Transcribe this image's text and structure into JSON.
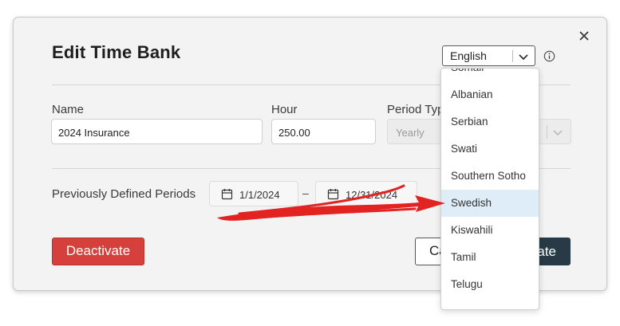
{
  "dialog": {
    "title": "Edit Time Bank",
    "language": {
      "selected": "English"
    },
    "fields": {
      "name": {
        "label": "Name",
        "value": "2024 Insurance"
      },
      "hour": {
        "label": "Hour",
        "value": "250.00"
      },
      "period_type": {
        "label": "Period Type",
        "value": "Yearly"
      }
    },
    "previous_periods": {
      "label": "Previously Defined Periods",
      "start": "1/1/2024",
      "separator": "–",
      "end": "12/31/2024"
    },
    "buttons": {
      "deactivate": "Deactivate",
      "cancel": "Cancel",
      "update": "Update"
    }
  },
  "dropdown": {
    "items": [
      "Somali",
      "Albanian",
      "Serbian",
      "Swati",
      "Southern Sotho",
      "Swedish",
      "Kiswahili",
      "Tamil",
      "Telugu"
    ],
    "highlighted": "Swedish"
  },
  "colors": {
    "deactivate": "#d5403d",
    "update": "#273a45",
    "highlight": "#deedf8",
    "annotation_arrow": "#e32222"
  },
  "icons": [
    "close-icon",
    "chevron-down-icon",
    "info-icon",
    "calendar-icon"
  ]
}
